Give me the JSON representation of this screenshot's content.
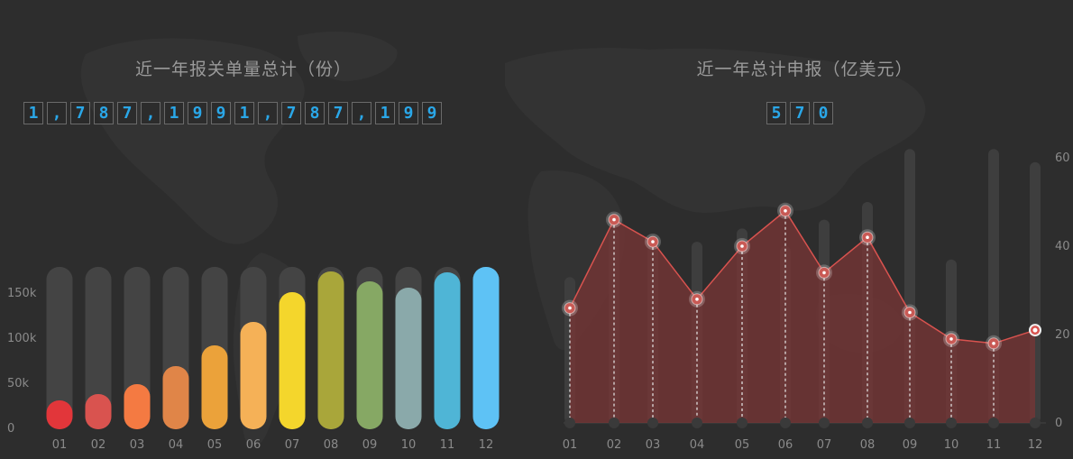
{
  "chart_data": [
    {
      "type": "bar",
      "title": "近一年报关单量总计（份）",
      "total_digits": [
        "1",
        ",",
        "7",
        "8",
        "7",
        ",",
        "1",
        "9",
        "9",
        "1",
        ",",
        "7",
        "8",
        "7",
        ",",
        "1",
        "9",
        "9"
      ],
      "categories": [
        "01",
        "02",
        "03",
        "04",
        "05",
        "06",
        "07",
        "08",
        "09",
        "10",
        "11",
        "12"
      ],
      "values": [
        32000,
        39000,
        50000,
        70000,
        93000,
        119000,
        152000,
        175000,
        164000,
        157000,
        174000,
        180000
      ],
      "ylim": [
        0,
        180000
      ],
      "yticks": [
        {
          "value": 0,
          "label": "0"
        },
        {
          "value": 50000,
          "label": "50k"
        },
        {
          "value": 100000,
          "label": "100k"
        },
        {
          "value": 150000,
          "label": "150k"
        }
      ],
      "colors": [
        "#e2363a",
        "#d9534f",
        "#f47a42",
        "#e08548",
        "#eba23a",
        "#f5b157",
        "#f4d62c",
        "#a9a63a",
        "#86a864",
        "#8aa9aa",
        "#4fb5d6",
        "#5ec2f5"
      ],
      "track_color": "#444444"
    },
    {
      "type": "area",
      "title": "近一年总计申报（亿美元）",
      "total_digits": [
        "5",
        "7",
        "0"
      ],
      "categories": [
        "01",
        "02",
        "03",
        "04",
        "05",
        "06",
        "07",
        "08",
        "09",
        "10",
        "11",
        "12"
      ],
      "values": [
        26,
        46,
        41,
        28,
        40,
        48,
        34,
        42,
        25,
        19,
        18,
        21
      ],
      "bars": [
        33,
        44,
        40,
        41,
        44,
        40,
        46,
        50,
        62,
        37,
        62,
        59
      ],
      "ylim": [
        0,
        60
      ],
      "yticks": [
        {
          "value": 0,
          "label": "0"
        },
        {
          "value": 20,
          "label": "20"
        },
        {
          "value": 40,
          "label": "40"
        },
        {
          "value": 60,
          "label": "60"
        }
      ],
      "line_color": "#d9534f",
      "fill_color": "#7a3535",
      "bar_color": "#3e3e3e"
    }
  ]
}
